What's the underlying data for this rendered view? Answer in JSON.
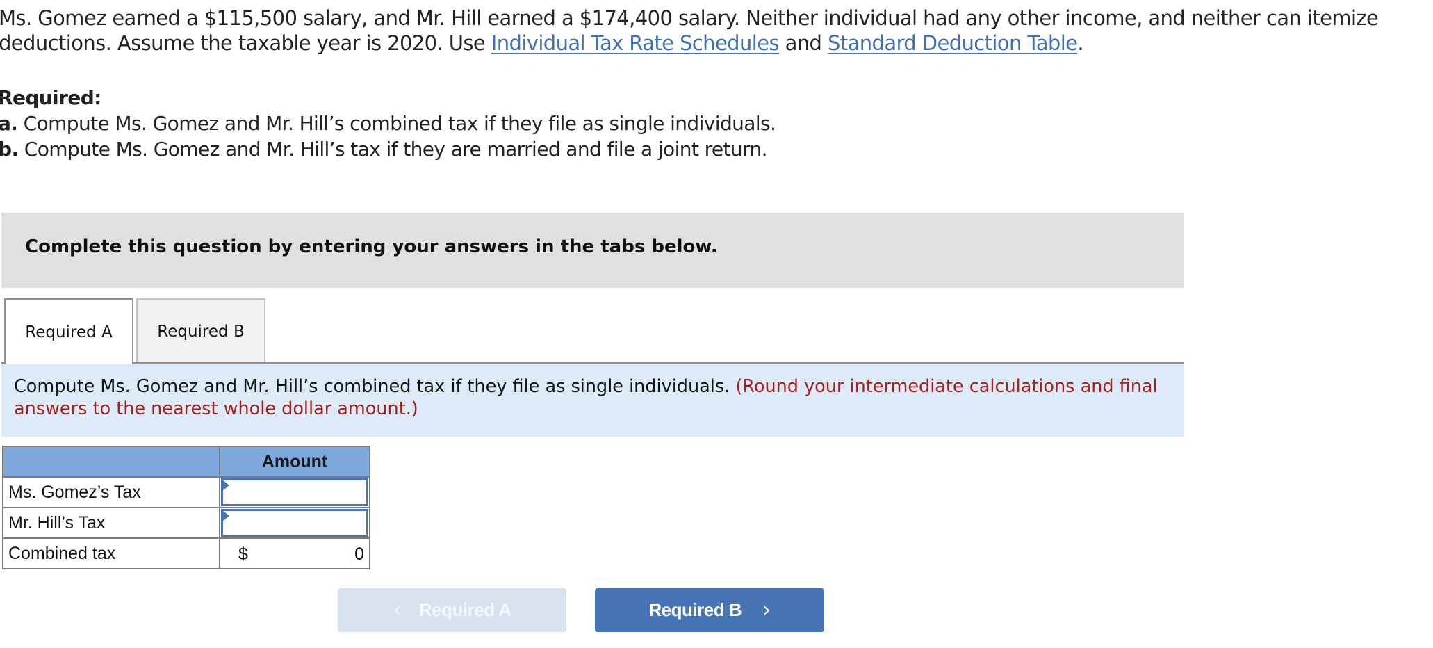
{
  "problem": {
    "text_before_links": "Ms. Gomez earned a $115,500 salary, and Mr. Hill earned a $174,400 salary. Neither individual had any other income, and neither can itemize deductions. Assume the taxable year is 2020. Use ",
    "link1": "Individual Tax Rate Schedules",
    "between_links": " and ",
    "link2": "Standard Deduction Table",
    "after_links": "."
  },
  "required": {
    "heading": "Required:",
    "items": [
      {
        "marker": "a.",
        "text": " Compute Ms. Gomez and Mr. Hill’s combined tax if they file as single individuals."
      },
      {
        "marker": "b.",
        "text": " Compute Ms. Gomez and Mr. Hill’s tax if they are married and file a joint return."
      }
    ]
  },
  "banner": {
    "text": "Complete this question by entering your answers in the tabs below."
  },
  "tabs": [
    {
      "label": "Required A",
      "active": true
    },
    {
      "label": "Required B",
      "active": false
    }
  ],
  "instruction": {
    "text": "Compute Ms. Gomez and Mr. Hill’s combined tax if they file as single individuals. ",
    "note": "(Round your intermediate calculations and final answers to the nearest whole dollar amount.)"
  },
  "table": {
    "header": [
      "",
      "Amount"
    ],
    "rows": [
      {
        "label": "Ms. Gomez’s Tax",
        "value": ""
      },
      {
        "label": "Mr. Hill’s Tax",
        "value": ""
      },
      {
        "label": "Combined tax",
        "currency": "$",
        "value": "0"
      }
    ]
  },
  "nav": {
    "prev_label": "Required A",
    "next_label": "Required B",
    "prev_icon": "‹",
    "next_icon": "›"
  },
  "colors": {
    "link": "#3f6fb5",
    "note_red": "#a4201c",
    "button_primary": "#4674b4",
    "button_disabled": "#d8e2ee",
    "table_header": "#7fa8dc",
    "instruction_bg": "#ddebf8",
    "banner_bg": "#e0e0e0"
  }
}
